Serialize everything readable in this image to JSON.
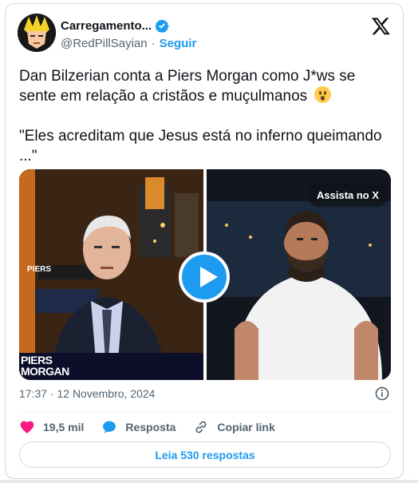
{
  "author": {
    "display_name": "Carregamento...",
    "handle": "@RedPillSayian",
    "separator": "·",
    "follow_label": "Seguir"
  },
  "tweet": {
    "text_line1": "Dan Bilzerian conta a Piers Morgan como J*ws se sente em relação a cristãos e muçulmanos ",
    "quote": "\"Eles acreditam que Jesus está no inferno queimando ...\"",
    "timestamp": "17:37 · 12 Novembro, 2024"
  },
  "media": {
    "watch_label": "Assista no X",
    "logo_line1": "PIERS",
    "logo_line2": "MORGAN",
    "overlay_text": "PIERS"
  },
  "actions": {
    "likes": "19,5 mil",
    "reply_label": "Resposta",
    "copy_link_label": "Copiar link"
  },
  "read_replies_label": "Leia 530 respostas",
  "colors": {
    "accent": "#1d9bf0",
    "like": "#f91880",
    "secondary_text": "#536471"
  },
  "icons": [
    "verified-badge-icon",
    "x-logo-icon",
    "play-icon",
    "info-icon",
    "heart-icon",
    "reply-bubble-icon",
    "link-icon"
  ]
}
